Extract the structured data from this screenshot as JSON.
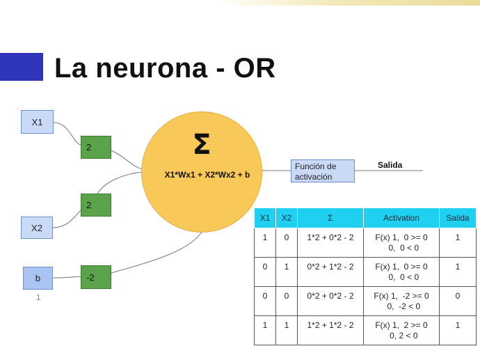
{
  "title": "La neurona - OR",
  "colors": {
    "accent_block": "#2e35b8",
    "input_fill": "#c9d9f6",
    "weight_fill": "#5aa34a",
    "neuron_fill": "#f8c858",
    "table_header": "#1fd0f0"
  },
  "diagram": {
    "inputs": [
      {
        "label": "X1"
      },
      {
        "label": "X2"
      },
      {
        "label": "b",
        "sublabel": "1"
      }
    ],
    "weights": [
      "2",
      "2",
      "-2"
    ],
    "neuron": {
      "symbol": "Σ",
      "formula": "X1*Wx1 + X2*Wx2 + b"
    },
    "activation_box": {
      "line1": "Función de",
      "line2": "activación"
    },
    "output_label": "Salida"
  },
  "table": {
    "headers": [
      "X1",
      "X2",
      "Σ",
      "Activation",
      "Salida"
    ],
    "rows": [
      {
        "x1": "1",
        "x2": "0",
        "sum": "1*2 + 0*2 - 2",
        "activation": "F(x) 1,  0 >= 0\n  0,  0 < 0",
        "salida": "1"
      },
      {
        "x1": "0",
        "x2": "1",
        "sum": "0*2 + 1*2 - 2",
        "activation": "F(x) 1,  0 >= 0\n  0,  0 < 0",
        "salida": "1"
      },
      {
        "x1": "0",
        "x2": "0",
        "sum": "0*2 + 0*2 - 2",
        "activation": "F(x) 1,  -2 >= 0\n  0,  -2 < 0",
        "salida": "0"
      },
      {
        "x1": "1",
        "x2": "1",
        "sum": "1*2 + 1*2 - 2",
        "activation": "F(x) 1,  2 >= 0\n  0, 2 < 0",
        "salida": "1"
      }
    ]
  }
}
